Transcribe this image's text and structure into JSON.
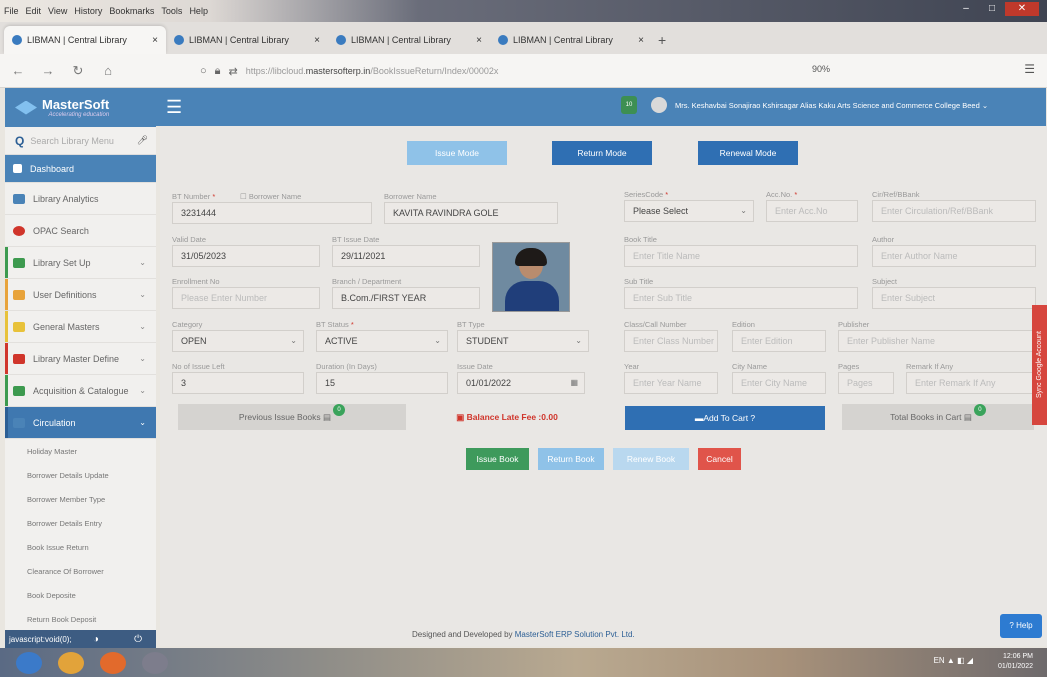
{
  "browser": {
    "menu": [
      "File",
      "Edit",
      "View",
      "History",
      "Bookmarks",
      "Tools",
      "Help"
    ],
    "tabs": [
      {
        "label": "LIBMAN | Central Library",
        "close": "×"
      },
      {
        "label": "LIBMAN | Central Library",
        "close": "×"
      },
      {
        "label": "LIBMAN | Central Library",
        "close": "×"
      },
      {
        "label": "LIBMAN | Central Library",
        "close": "×"
      }
    ],
    "new_tab": "+",
    "url_prefix": "https://libcloud.",
    "url_domain": "mastersofterp.in",
    "url_path": "/BookIssueReturn/Index/00002x",
    "zoom": "90%"
  },
  "app": {
    "logo_name": "MasterSoft",
    "logo_tagline": "Accelerating education",
    "search_placeholder": "Search Library Menu",
    "user_name": "Mrs. Keshavbai Sonajirao Kshirsagar Alias Kaku Arts Science and Commerce College Beed",
    "notif": "10"
  },
  "sidebar": {
    "items": [
      {
        "label": "Dashboard",
        "color": "#ffffff"
      },
      {
        "label": "Library Analytics",
        "color": "#4a83b7"
      },
      {
        "label": "OPAC Search",
        "color": "#d0352b"
      },
      {
        "label": "Library Set Up",
        "color": "#3d9a4f"
      },
      {
        "label": "User Definitions",
        "color": "#e8a33a"
      },
      {
        "label": "General Masters",
        "color": "#e8c23a"
      },
      {
        "label": "Library Master Define",
        "color": "#d0352b"
      },
      {
        "label": "Acquisition & Catalogue",
        "color": "#3d9a4f"
      },
      {
        "label": "Circulation",
        "color": "#ffffff"
      }
    ],
    "sub_items": [
      "Holiday Master",
      "Borrower Details Update",
      "Borrower Member Type",
      "Borrower Details Entry",
      "Book Issue Return",
      "Clearance Of Borrower",
      "Book Deposite",
      "Return Book Deposit"
    ]
  },
  "status_text": "javascript:void(0);",
  "modes": {
    "issue": "Issue Mode",
    "return": "Return Mode",
    "renewal": "Renewal Mode"
  },
  "form": {
    "bt_number_label": "BT Number",
    "borrower_name_check_label": "Borrower Name",
    "bt_number": "3231444",
    "borrower_name_label": "Borrower Name",
    "borrower_name": "KAVITA RAVINDRA GOLE",
    "valid_date_label": "Valid Date",
    "valid_date": "31/05/2023",
    "bt_issue_date_label": "BT Issue Date",
    "bt_issue_date": "29/11/2021",
    "enrollment_label": "Enrollment No",
    "enrollment_placeholder": "Please Enter Number",
    "branch_label": "Branch / Department",
    "branch": "B.Com./FIRST YEAR",
    "category_label": "Category",
    "category": "OPEN",
    "bt_status_label": "BT Status",
    "bt_status": "ACTIVE",
    "bt_type_label": "BT Type",
    "bt_type": "STUDENT",
    "issue_left_label": "No of Issue Left",
    "issue_left": "3",
    "duration_label": "Duration (In Days)",
    "duration": "15",
    "issue_date_label": "Issue Date",
    "issue_date": "01/01/2022",
    "series_label": "SeriesCode",
    "series": "Please Select",
    "acc_label": "Acc.No.",
    "acc_placeholder": "Enter Acc.No",
    "circ_label": "Cir/Ref/BBank",
    "circ_placeholder": "Enter Circulation/Ref/BBank",
    "title_label": "Book Title",
    "title_placeholder": "Enter Title Name",
    "author_label": "Author",
    "author_placeholder": "Enter Author Name",
    "subtitle_label": "Sub Title",
    "subtitle_placeholder": "Enter Sub Title",
    "subject_label": "Subject",
    "subject_placeholder": "Enter Subject",
    "class_label": "Class/Call Number",
    "class_placeholder": "Enter Class Number",
    "edition_label": "Edition",
    "edition_placeholder": "Enter Edition",
    "publisher_label": "Publisher",
    "publisher_placeholder": "Enter Publisher Name",
    "year_label": "Year",
    "year_placeholder": "Enter Year Name",
    "city_label": "City Name",
    "city_placeholder": "Enter City Name",
    "pages_label": "Pages",
    "pages_placeholder": "Pages",
    "remark_label": "Remark If Any",
    "remark_placeholder": "Enter Remark If Any"
  },
  "actions": {
    "previous_issue": "Previous Issue Books",
    "previous_count": "0",
    "balance_fee": "Balance Late Fee :0.00",
    "add_cart": "Add To Cart ?",
    "total_books": "Total Books in Cart",
    "total_count": "0",
    "issue": "Issue Book",
    "return": "Return Book",
    "renew": "Renew Book",
    "cancel": "Cancel"
  },
  "footer": {
    "prefix": "Designed and Developed by",
    "company": "MasterSoft ERP Solution Pvt. Ltd."
  },
  "sync_label": "Sync Google Account",
  "help_label": "Help",
  "taskbar": {
    "lang": "EN",
    "time": "12:06 PM",
    "date": "01/01/2022"
  }
}
